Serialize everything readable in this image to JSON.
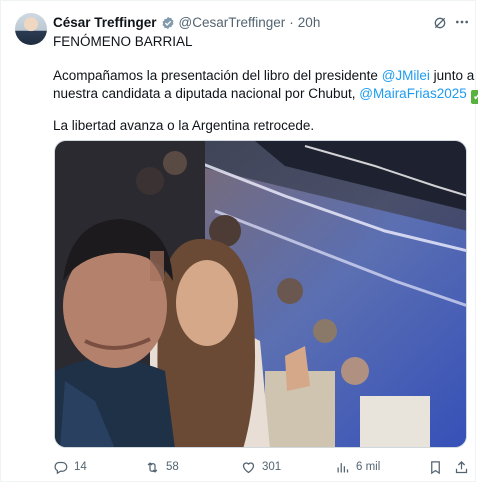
{
  "post": {
    "author_name": "César Treffinger",
    "handle": "@CesarTreffinger",
    "separator": "·",
    "time": "20h",
    "line1": "FENÓMENO BARRIAL",
    "line2_a": "Acompañamos la presentación del libro del presidente ",
    "mention1": "@JMilei",
    "line2_b": " junto a",
    "line3_a": "nuestra candidata a diputada nacional por Chubut, ",
    "mention2": "@MairaFrias2025",
    "check": "✓",
    "line4": "La libertad avanza o la Argentina retrocede."
  },
  "icons": {
    "verified": "verified-badge-icon",
    "grok": "grok-icon",
    "more": "more-icon",
    "reply": "reply-icon",
    "repost": "repost-icon",
    "like": "like-icon",
    "views": "views-icon",
    "bookmark": "bookmark-icon",
    "share": "share-icon"
  },
  "actions": {
    "replies": "14",
    "reposts": "58",
    "likes": "301",
    "views": "6 mil"
  },
  "colors": {
    "accent": "#1d9bf0",
    "text": "#0f1419",
    "muted": "#536471",
    "check": "#57b33e"
  }
}
